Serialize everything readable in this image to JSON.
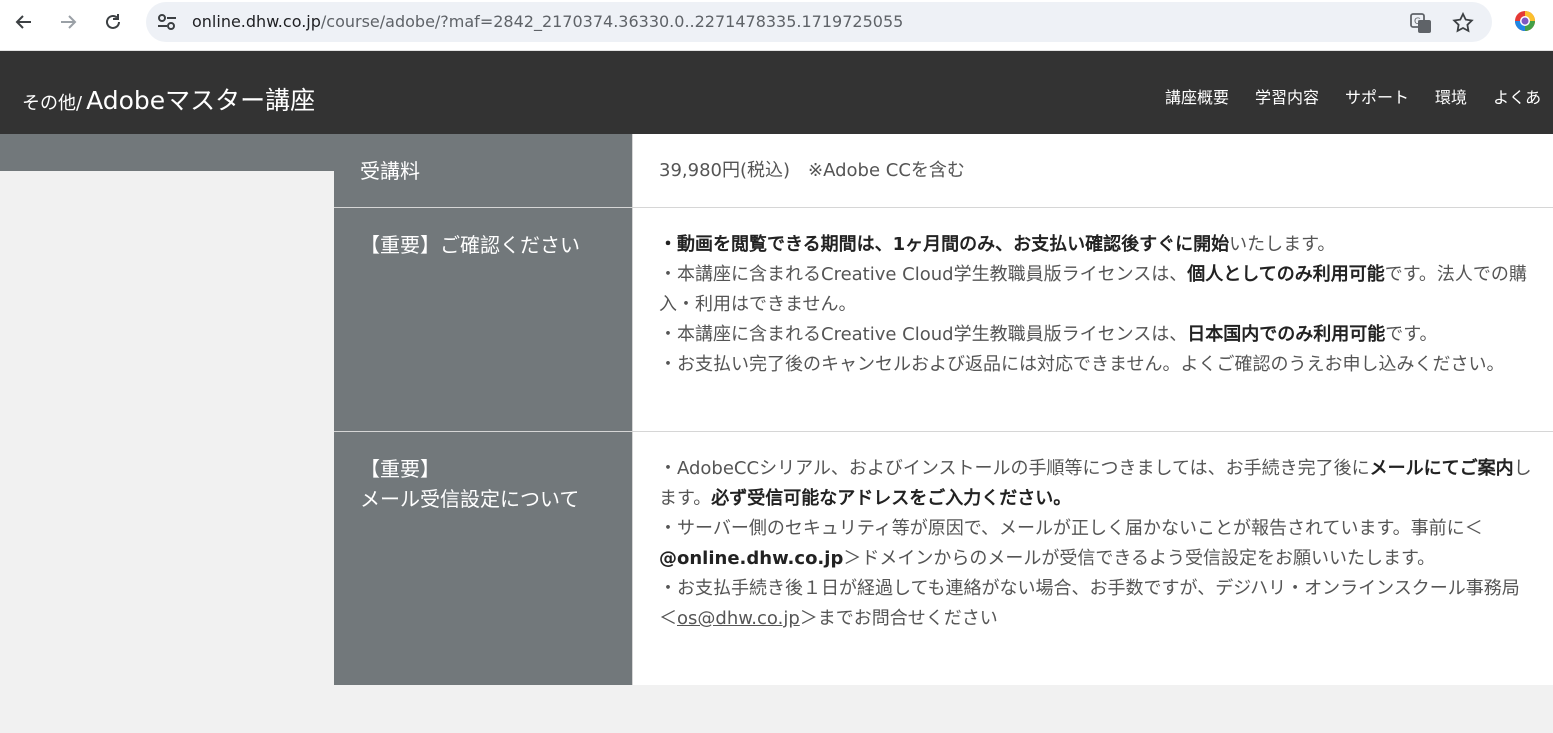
{
  "browser": {
    "url_host": "online.dhw.co.jp",
    "url_rest": "/course/adobe/?maf=2842_2170374.36330.0..2271478335.1719725055"
  },
  "site": {
    "logo_small": "その他/",
    "logo_title": "Adobeマスター講座",
    "nav": [
      "講座概要",
      "学習内容",
      "サポート",
      "環境",
      "よくあ"
    ]
  },
  "table": {
    "fee": {
      "label": "受講料",
      "value": "39,980円(税込)　※Adobe CCを含む"
    },
    "confirm": {
      "label": "【重要】ご確認ください",
      "l1_bold": "・動画を閲覧できる期間は、1ヶ月間のみ、お支払い確認後すぐに開始",
      "l1_tail": "いたします。",
      "l2_head": "・本講座に含まれるCreative Cloud学生教職員版ライセンスは、",
      "l2_bold": "個人としてのみ利用可能",
      "l2_tail": "です。法人での購入・利用はできません。",
      "l3_head": "・本講座に含まれるCreative Cloud学生教職員版ライセンスは、",
      "l3_bold": "日本国内でのみ利用可能",
      "l3_tail": "です。",
      "l4": "・お支払い完了後のキャンセルおよび返品には対応できません。よくご確認のうえお申し込みください。"
    },
    "mail": {
      "label_1": "【重要】",
      "label_2": "メール受信設定について",
      "m1_head": "・AdobeCCシリアル、およびインストールの手順等につきましては、お手続き完了後に",
      "m1_bold": "メールにてご案内",
      "m1_mid": "します。",
      "m1_bold2": "必ず受信可能なアドレスをご入力ください。",
      "m2_head": "・サーバー側のセキュリティ等が原因で、メールが正しく届かないことが報告されています。事前に＜",
      "m2_bold": "@online.dhw.co.jp",
      "m2_tail": "＞ドメインからのメールが受信できるよう受信設定をお願いいたします。",
      "m3_head": "・お支払手続き後１日が経過しても連絡がない場合、お手数ですが、デジハリ・オンラインスクール事務局＜",
      "m3_link": "os@dhw.co.jp",
      "m3_tail": "＞までお問合せください"
    }
  }
}
